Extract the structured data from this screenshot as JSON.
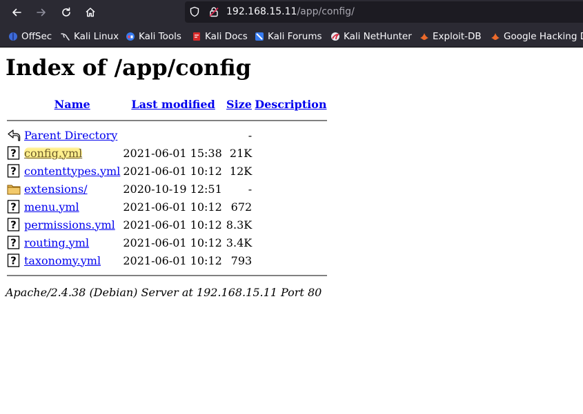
{
  "browser": {
    "url_host": "192.168.15.11",
    "url_path": "/app/config/",
    "bookmarks": [
      {
        "label": "OffSec",
        "icon": "offsec-icon"
      },
      {
        "label": "Kali Linux",
        "icon": "kali-dragon-icon"
      },
      {
        "label": "Kali Tools",
        "icon": "kali-tools-icon"
      },
      {
        "label": "Kali Docs",
        "icon": "kali-docs-icon"
      },
      {
        "label": "Kali Forums",
        "icon": "kali-forums-icon"
      },
      {
        "label": "Kali NetHunter",
        "icon": "nethunter-icon"
      },
      {
        "label": "Exploit-DB",
        "icon": "exploit-db-icon"
      },
      {
        "label": "Google Hacking D",
        "icon": "ghdb-icon"
      }
    ]
  },
  "page": {
    "title": "Index of /app/config",
    "columns": {
      "name": "Name",
      "modified": "Last modified",
      "size": "Size",
      "description": "Description"
    },
    "parent": {
      "label": "Parent Directory",
      "size": "-"
    },
    "files": [
      {
        "name": "config.yml",
        "modified": "2021-06-01 15:38",
        "size": "21K",
        "type": "file",
        "highlighted": true
      },
      {
        "name": "contenttypes.yml",
        "modified": "2021-06-01 10:12",
        "size": "12K",
        "type": "file"
      },
      {
        "name": "extensions/",
        "modified": "2020-10-19 12:51",
        "size": "-",
        "type": "folder"
      },
      {
        "name": "menu.yml",
        "modified": "2021-06-01 10:12",
        "size": "672",
        "type": "file"
      },
      {
        "name": "permissions.yml",
        "modified": "2021-06-01 10:12",
        "size": "8.3K",
        "type": "file"
      },
      {
        "name": "routing.yml",
        "modified": "2021-06-01 10:12",
        "size": "3.4K",
        "type": "file"
      },
      {
        "name": "taxonomy.yml",
        "modified": "2021-06-01 10:12",
        "size": "793",
        "type": "file"
      }
    ],
    "footer": "Apache/2.4.38 (Debian) Server at 192.168.15.11 Port 80"
  },
  "colors": {
    "chrome": "#2b2a33",
    "urlbar": "#1c1b22",
    "link": "#0000ee",
    "highlight": "#ffec78"
  }
}
